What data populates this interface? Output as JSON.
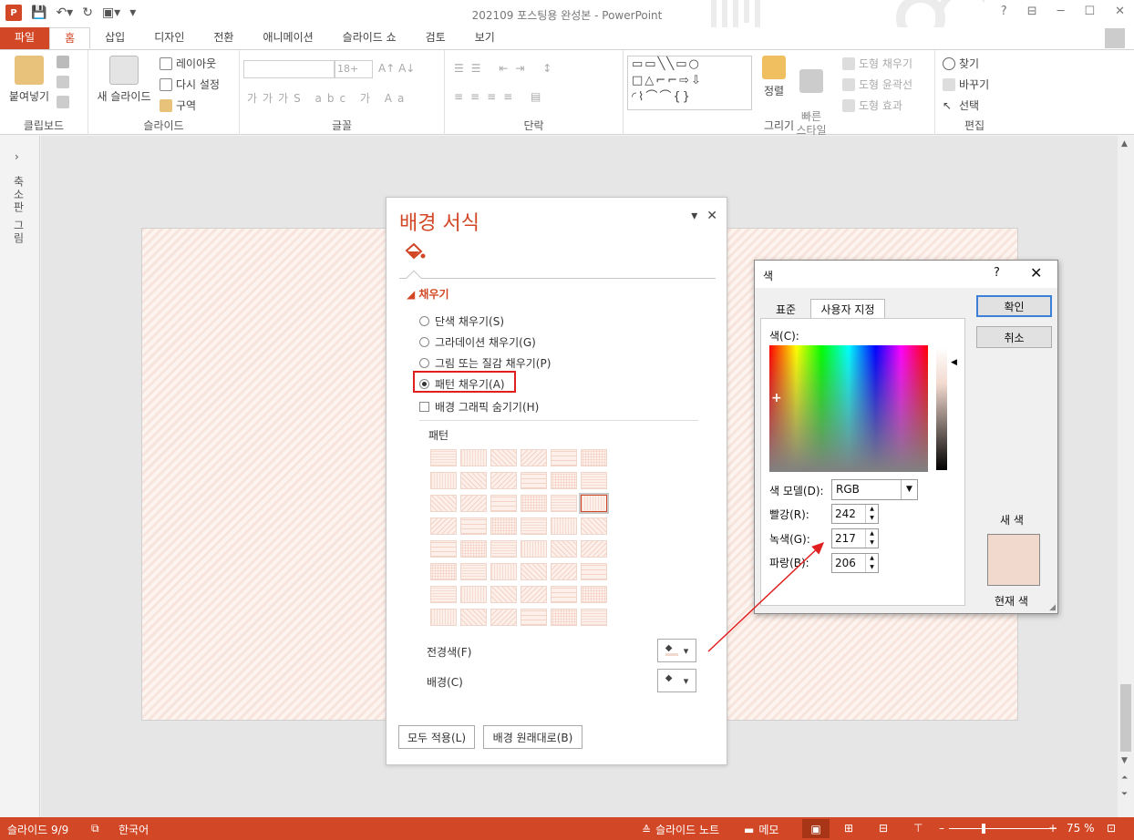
{
  "window": {
    "title": "202109 포스팅용 완성본 - PowerPoint",
    "help": "?",
    "controls": [
      "⊟",
      "─",
      "☐",
      "✕"
    ]
  },
  "tabs": [
    "파일",
    "홈",
    "삽입",
    "디자인",
    "전환",
    "애니메이션",
    "슬라이드 쇼",
    "검토",
    "보기"
  ],
  "ribbon": {
    "clipboard": {
      "paste": "붙여넣기",
      "label": "클립보드"
    },
    "slides": {
      "new_slide": "새 슬라이드",
      "layout": "레이아웃",
      "reset": "다시 설정",
      "section": "구역",
      "label": "슬라이드"
    },
    "font": {
      "size": "18+",
      "label": "글꼴"
    },
    "paragraph": {
      "label": "단락"
    },
    "drawing": {
      "arrange": "정렬",
      "quick_styles": "빠른\n스타일",
      "shape_fill": "도형 채우기",
      "shape_outline": "도형 윤곽선",
      "shape_effects": "도형 효과",
      "label": "그리기"
    },
    "editing": {
      "find": "찾기",
      "replace": "바꾸기",
      "select": "선택",
      "label": "편집"
    }
  },
  "thumbnails": {
    "label": "축소판 그림"
  },
  "format_pane": {
    "title": "배경 서식",
    "section": "채우기",
    "options": [
      "단색 채우기(S)",
      "그라데이션 채우기(G)",
      "그림 또는 질감 채우기(P)",
      "패턴 채우기(A)"
    ],
    "selected_option": "패턴 채우기(A)",
    "hide_graphics": "배경 그래픽 숨기기(H)",
    "pattern_label": "패턴",
    "foreground_label": "전경색(F)",
    "background_label": "배경(C)",
    "apply_all": "모두 적용(L)",
    "reset_background": "배경 원래대로(B)"
  },
  "color_dialog": {
    "title": "색",
    "tab_standard": "표준",
    "tab_custom": "사용자 지정",
    "colors_label": "색(C):",
    "color_model_label": "색 모델(D):",
    "color_model": "RGB",
    "red_label": "빨강(R):",
    "green_label": "녹색(G):",
    "blue_label": "파랑(B):",
    "red": "242",
    "green": "217",
    "blue": "206",
    "ok": "확인",
    "cancel": "취소",
    "new_label": "새 색",
    "current_label": "현재 색",
    "current_color": "#f2d9ce"
  },
  "status": {
    "slide": "슬라이드 9/9",
    "language": "한국어",
    "notes": "슬라이드 노트",
    "comments": "메모",
    "zoom": "75 %"
  },
  "colors": {
    "accent": "#d24726",
    "highlight": "#e02020"
  }
}
